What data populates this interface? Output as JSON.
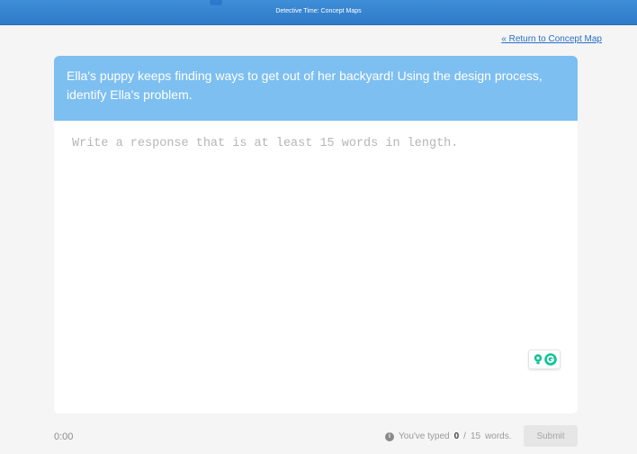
{
  "header": {
    "title": "Detective Time: Concept Maps"
  },
  "nav": {
    "return_link": "« Return to Concept Map"
  },
  "question": {
    "prompt": "Ella's puppy keeps finding ways to get out of her backyard! Using the design process, identify Ella's problem."
  },
  "response": {
    "placeholder": "Write a response that is at least 15 words in length.",
    "value": ""
  },
  "footer": {
    "timer": "0:00",
    "word_count": {
      "prefix": "You've typed",
      "typed": "0",
      "separator": "/",
      "required": "15",
      "suffix": "words."
    },
    "submit_label": "Submit"
  },
  "colors": {
    "header": "#3f8ed8",
    "prompt_bg": "#7dbff0",
    "link": "#2a6fc9",
    "grammarly": "#15c39a"
  },
  "icons": {
    "info": "info-icon",
    "grammarly_bulb": "lightbulb-icon",
    "grammarly_logo": "grammarly-icon"
  }
}
